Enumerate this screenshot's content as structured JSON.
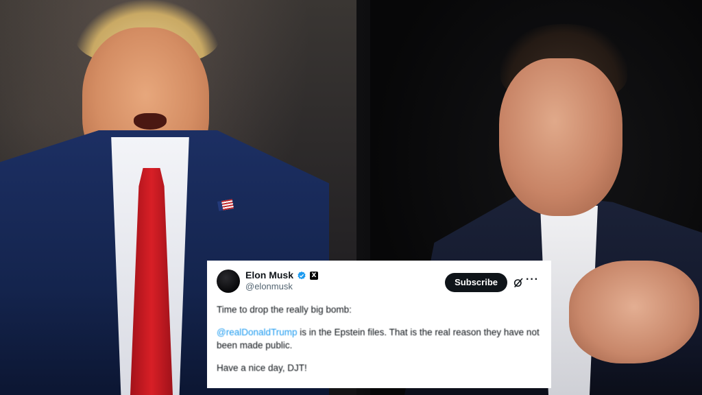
{
  "tweet": {
    "author_name": "Elon Musk",
    "handle": "@elonmusk",
    "subscribe_label": "Subscribe",
    "more_label": "···",
    "platform_badge": "X",
    "line1": "Time to drop the really big bomb:",
    "mention": "@realDonaldTrump",
    "line2_rest": " is in the Epstein files. That is the real reason they have not been made public.",
    "line3": "Have a nice day, DJT!"
  },
  "icons": {
    "verified": "verified-badge-icon",
    "grok": "grok-icon",
    "more": "more-options-icon",
    "avatar": "avatar"
  },
  "colors": {
    "verified": "#1d9bf0",
    "mention": "#1d9bf0",
    "subscribe_bg": "#0f1419",
    "card_bg": "#ffffff",
    "tie_red": "#d81f26",
    "suit_navy": "#1c2f63"
  }
}
